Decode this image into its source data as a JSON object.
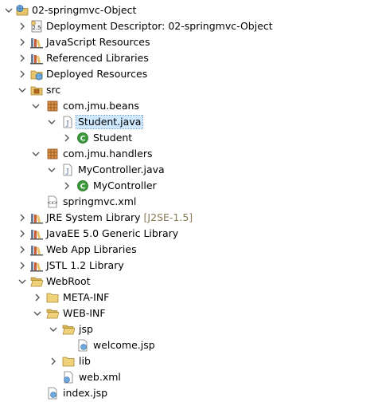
{
  "project": {
    "name": "02-springmvc-Object"
  },
  "tree": {
    "deployment_descriptor": "Deployment Descriptor: 02-springmvc-Object",
    "javascript_resources": "JavaScript Resources",
    "referenced_libraries": "Referenced Libraries",
    "deployed_resources": "Deployed Resources",
    "src": "src",
    "pkg_beans": "com.jmu.beans",
    "student_java": "Student.java",
    "student_class": "Student",
    "pkg_handlers": "com.jmu.handlers",
    "mycontroller_java": "MyController.java",
    "mycontroller_class": "MyController",
    "springmvc_xml": "springmvc.xml",
    "jre_library": "JRE System Library",
    "jre_decoration": "[J2SE-1.5]",
    "javaee_library": "JavaEE 5.0 Generic Library",
    "webapp_libraries": "Web App Libraries",
    "jstl_library": "JSTL 1.2 Library",
    "webroot": "WebRoot",
    "meta_inf": "META-INF",
    "web_inf": "WEB-INF",
    "jsp_folder": "jsp",
    "welcome_jsp": "welcome.jsp",
    "lib_folder": "lib",
    "web_xml": "web.xml",
    "index_jsp": "index.jsp"
  },
  "selected_item": "Student.java",
  "colors": {
    "folder": "#e8c46a",
    "package": "#b5651d",
    "class_badge": "#3c9a3c",
    "library_stack": "#6c7e9a",
    "selection": "#cde8ff",
    "decoration": "#8a7a56"
  }
}
